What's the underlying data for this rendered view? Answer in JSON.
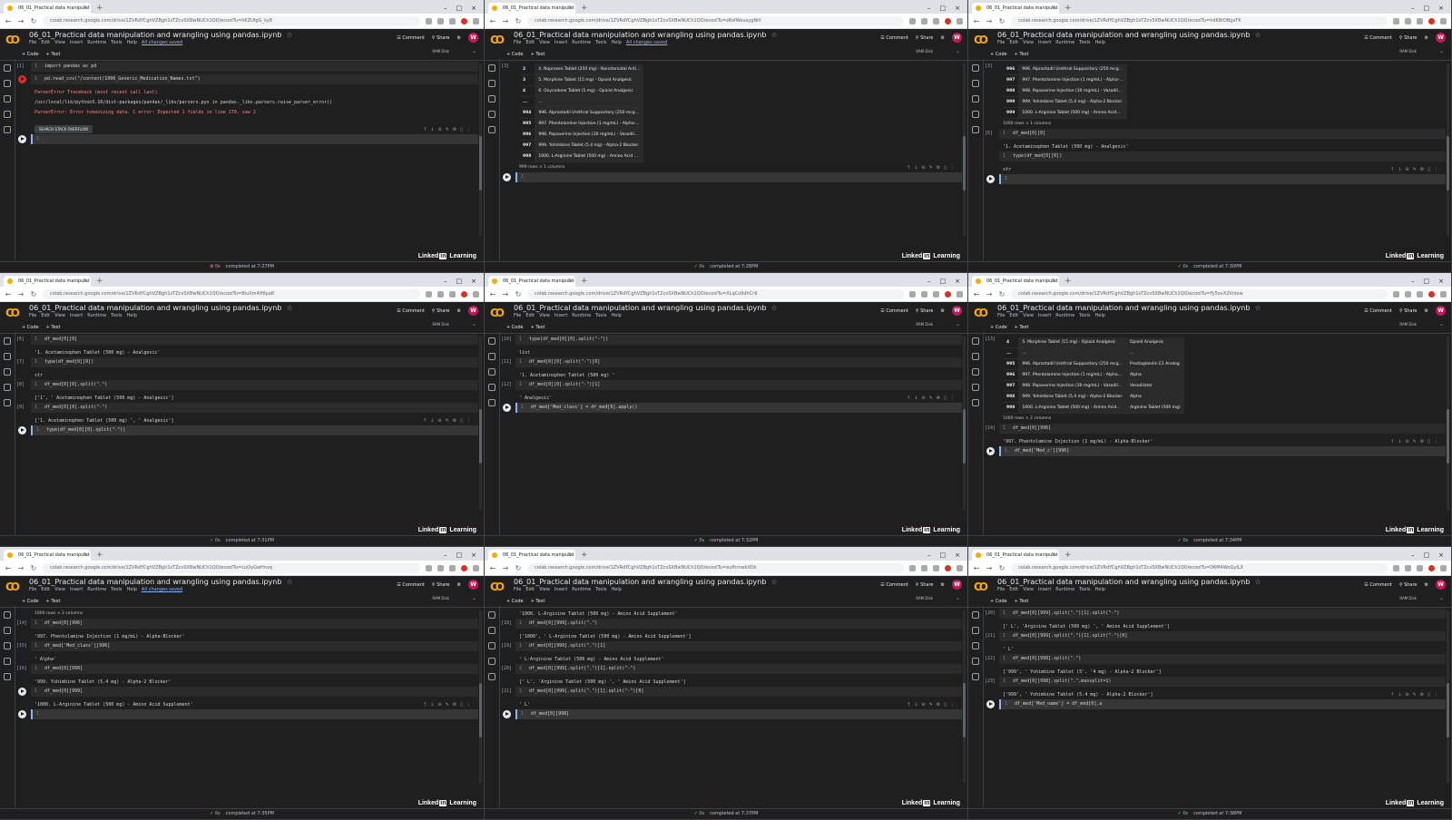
{
  "tab_title": "06_01_Practical data manipulat",
  "notebook_title": "06_01_Practical data manipulation and  wrangling using pandas.ipynb",
  "menus": [
    "File",
    "Edit",
    "View",
    "Insert",
    "Runtime",
    "Tools",
    "Help"
  ],
  "saved_text": "All changes saved",
  "header_buttons": {
    "comment": "Comment",
    "share": "Share",
    "avatar": "W"
  },
  "toolbar": {
    "code": "+ Code",
    "text": "+ Text",
    "ramdisk": "RAM Disk"
  },
  "watermark": "Linked in Learning",
  "url_prefix": "colab.research.google.com/drive/1ZVRdYCghVZBgh1sTZcvSXBwNUCh1QO/ecoolTu=",
  "panes": [
    {
      "url_suffix": "hKZUfgG_ky8",
      "show_saved": true,
      "status": "completed at 7:27PM",
      "status_sec": "0s",
      "status_err": true,
      "items": [
        {
          "k": "cell",
          "n": "[1]",
          "code": "import pandas as pd"
        },
        {
          "k": "cell",
          "n": "",
          "code": "pd.read_csv(\"/content/1000_Generic_Medication_Names.txt\")",
          "err": true
        },
        {
          "k": "out",
          "red": true,
          "text": "ParserError                          Traceback (most recent call last)"
        },
        {
          "k": "out",
          "text": "/usr/local/lib/python3.10/dist-packages/pandas/_libs/parsers.pyx in pandas._libs.parsers.raise_parser_error()"
        },
        {
          "k": "out",
          "red": true,
          "text": "ParserError: Error tokenizing data. C error: Expected 1 fields in line 170, saw 2"
        },
        {
          "k": "btn",
          "text": "SEARCH STACK OVERFLOW"
        },
        {
          "k": "cell",
          "n": "",
          "code": "",
          "run": true,
          "focus": true
        }
      ]
    },
    {
      "url_suffix": "zRsfWeusygNhl",
      "show_saved": true,
      "status": "completed at 7:28PM",
      "status_sec": "0s",
      "items": [
        {
          "k": "table",
          "n": "[3]",
          "rows": [
            [
              "2",
              "4. Naproxen Tablet (250 mg) - Nonsteroidal Anti..."
            ],
            [
              "3",
              "5. Morphine Tablet (15 mg) - Opioid Analgesic"
            ],
            [
              "4",
              "6. Oxycodone Tablet (5 mg) - Opioid Analgesic"
            ],
            [
              "...",
              "..."
            ],
            [
              "994",
              "996. Alprostadil Urethral Suppository (250 mcg..."
            ],
            [
              "995",
              "997. Phentolamine Injection (1 mg/mL) - Alpha-..."
            ],
            [
              "996",
              "998. Papaverine Injection (30 mg/mL) - Vasodil..."
            ],
            [
              "997",
              "999. Yohimbine Tablet (5.4 mg) - Alpha-2 Blocker"
            ],
            [
              "998",
              "1000. L-Arginine Tablet (500 mg) - Amino Acid ..."
            ]
          ]
        },
        {
          "k": "info",
          "text": "999 rows × 1 columns"
        },
        {
          "k": "cell",
          "n": "",
          "code": "",
          "run": true,
          "focus": true
        }
      ]
    },
    {
      "url_suffix": "hdK8rDBgsTK",
      "show_saved": false,
      "status": "completed at 7:30PM",
      "status_sec": "0s",
      "items": [
        {
          "k": "table",
          "n": "[3]",
          "rows": [
            [
              "996",
              "996. Alprostadil Urethral Suppository (250 mcg..."
            ],
            [
              "997",
              "997. Phentolamine Injection (1 mg/mL) - Alpha-..."
            ],
            [
              "998",
              "998. Papaverine Injection (30 mg/mL) - Vasodil..."
            ],
            [
              "999",
              "999. Yohimbine Tablet (5.4 mg) - Alpha-2 Blocker"
            ],
            [
              "999",
              "1000. L-Arginine Tablet (500 mg) - Amino Acid..."
            ]
          ]
        },
        {
          "k": "info",
          "text": "1000 rows × 1 columns"
        },
        {
          "k": "cell",
          "n": "[6]",
          "code": "df_med[0][0]"
        },
        {
          "k": "out",
          "text": "'1. Acetaminophen Tablet (500 mg) - Analgesic'"
        },
        {
          "k": "cell",
          "n": "",
          "code": "type(df_med[0][0])"
        },
        {
          "k": "out",
          "text": "str"
        },
        {
          "k": "cell",
          "n": "",
          "code": "",
          "run": true,
          "focus": true
        }
      ]
    },
    {
      "url_suffix": "BiuXm4H6pa8",
      "show_saved": false,
      "status": "completed at 7:31PM",
      "status_sec": "0s",
      "items": [
        {
          "k": "cell",
          "n": "[6]",
          "code": "df_med[0][0]"
        },
        {
          "k": "out",
          "text": "'1. Acetaminophen Tablet (500 mg) - Analgesic'"
        },
        {
          "k": "cell",
          "n": "[7]",
          "code": "type(df_med[0][0])"
        },
        {
          "k": "out",
          "text": "str"
        },
        {
          "k": "cell",
          "n": "[8]",
          "code": "df_med[0][0].split(\".\")"
        },
        {
          "k": "out",
          "text": "['1', ' Acetaminophen Tablet (500 mg) - Analgesic']"
        },
        {
          "k": "cell",
          "n": "[9]",
          "code": "df_med[0][0].split(\"-\")"
        },
        {
          "k": "out",
          "text": "['1. Acetaminophen Tablet (500 mg) ', ' Analgesic']"
        },
        {
          "k": "cell",
          "n": "",
          "code": "type(df_med[0][0].split(\"-\"))",
          "run": true,
          "focus": true
        }
      ]
    },
    {
      "url_suffix": "XLqCo9dhCr9",
      "show_saved": false,
      "status": "completed at 7:32PM",
      "status_sec": "0s",
      "items": [
        {
          "k": "cell",
          "n": "[10]",
          "code": "type(df_med[0][0].split(\"-\"))"
        },
        {
          "k": "out",
          "text": "list"
        },
        {
          "k": "cell",
          "n": "[11]",
          "code": "df_med[0][0].split(\"-\")[0]"
        },
        {
          "k": "out",
          "text": "'1. Acetaminophen Tablet (500 mg) '"
        },
        {
          "k": "cell",
          "n": "[12]",
          "code": "df_med[0][0].split(\"-\")[1]"
        },
        {
          "k": "out",
          "text": "' Analgesic'"
        },
        {
          "k": "cell",
          "n": "",
          "code": "df_med['Med_class'] = df_med[0].apply()",
          "run": true,
          "focus": true
        }
      ]
    },
    {
      "url_suffix": "Fy5ovX2Vnlow",
      "show_saved": false,
      "status": "completed at 7:34PM",
      "status_sec": "0s",
      "items": [
        {
          "k": "table",
          "n": "[13]",
          "rows": [
            [
              "4",
              "5. Morphine Tablet (15 mg) - Opioid Analgesic",
              "Opioid Analgesic"
            ],
            [
              "...",
              "...",
              "..."
            ],
            [
              "995",
              "996. Alprostadil Urethral Suppository (250 mcg...",
              "Prostaglandin E1 Analog"
            ],
            [
              "996",
              "997. Phentolamine Injection (1 mg/mL) - Alpha...",
              "Alpha"
            ],
            [
              "997",
              "998. Papaverine Injection (30 mg/mL) - Vasodil...",
              "Vasodilator"
            ],
            [
              "998",
              "999. Yohimbine Tablet (5.4 mg) - Alpha-2 Blocker",
              "Alpha"
            ],
            [
              "999",
              "1000. L-Arginine Tablet (500 mg) - Amino Acid...",
              "Arginine Tablet (500 mg)"
            ]
          ]
        },
        {
          "k": "info",
          "text": "1000 rows × 2 columns"
        },
        {
          "k": "cell",
          "n": "[14]",
          "code": "df_med[0][996]"
        },
        {
          "k": "out",
          "text": "'997. Phentolamine Injection (1 mg/mL) - Alpha-Blocker'"
        },
        {
          "k": "cell",
          "n": "",
          "code": "df_med['Med_c'][996]",
          "run": true,
          "focus": true
        }
      ]
    },
    {
      "url_suffix": "cuOyGwHnvq",
      "show_saved": true,
      "status": "completed at 7:35PM",
      "status_sec": "0s",
      "items": [
        {
          "k": "info",
          "text": "1000 rows × 2 columns"
        },
        {
          "k": "cell",
          "n": "[14]",
          "code": "df_med[0][996]"
        },
        {
          "k": "out",
          "text": "'997. Phentolamine Injection (1 mg/mL) - Alpha-Blocker'"
        },
        {
          "k": "cell",
          "n": "[15]",
          "code": "df_med['Med_class'][996]"
        },
        {
          "k": "out",
          "text": "' Alpha'"
        },
        {
          "k": "cell",
          "n": "[16]",
          "code": "df_med[0][998]"
        },
        {
          "k": "out",
          "text": "'999. Yohimbine Tablet (5.4 mg) - Alpha-2 Blocker'"
        },
        {
          "k": "cell",
          "n": "",
          "code": "df_med[0][999]",
          "run": true
        },
        {
          "k": "out",
          "text": "'1000. L-Arginine Tablet (500 mg) - Amino Acid Supplement'"
        },
        {
          "k": "cell",
          "n": "",
          "code": "",
          "run": true,
          "focus": true
        }
      ]
    },
    {
      "url_suffix": "eufhrnwkXOk",
      "show_saved": false,
      "status": "completed at 7:37PM",
      "status_sec": "0s",
      "items": [
        {
          "k": "out",
          "text": "'1000. L-Arginine Tablet (500 mg) - Amino Acid Supplement'"
        },
        {
          "k": "cell",
          "n": "[18]",
          "code": "df_med[0][999].split(\".\")"
        },
        {
          "k": "out",
          "text": "['1000', ' L-Arginine Tablet (500 mg) - Amino Acid Supplement']"
        },
        {
          "k": "cell",
          "n": "[19]",
          "code": "df_med[0][999].split(\".\")[1]"
        },
        {
          "k": "out",
          "text": "' L-Arginine Tablet (500 mg) - Amino Acid Supplement'"
        },
        {
          "k": "cell",
          "n": "[20]",
          "code": "df_med[0][999].split(\".\")[1].split(\"-\")"
        },
        {
          "k": "out",
          "text": "[' L', 'Arginine Tablet (500 mg) ', ' Amino Acid Supplement']"
        },
        {
          "k": "cell",
          "n": "[21]",
          "code": "df_med[0][999].split(\".\")[1].split(\"-\")[0]"
        },
        {
          "k": "out",
          "text": "' L'"
        },
        {
          "k": "cell",
          "n": "",
          "code": "df_med[0][998]",
          "run": true,
          "focus": true
        }
      ]
    },
    {
      "url_suffix": "D6M4WoGyILX",
      "show_saved": false,
      "status": "completed at 7:38PM",
      "status_sec": "0s",
      "items": [
        {
          "k": "cell",
          "n": "[20]",
          "code": "df_med[0][999].split(\".\")[1].split(\"-\")"
        },
        {
          "k": "out",
          "text": "[' L', 'Arginine Tablet (500 mg) ', ' Amino Acid Supplement']"
        },
        {
          "k": "cell",
          "n": "[21]",
          "code": "df_med[0][999].split(\".\")[1].split(\"-\")[0]"
        },
        {
          "k": "out",
          "text": "' L'"
        },
        {
          "k": "cell",
          "n": "[22]",
          "code": "df_med[0][998].split(\".\")"
        },
        {
          "k": "out",
          "text": "['999', ' Yohimbine Tablet (5', '4 mg) - Alpha-2 Blocker']"
        },
        {
          "k": "cell",
          "n": "[23]",
          "code": "df_med[0][998].split(\".\",maxsplit=1)"
        },
        {
          "k": "out",
          "text": "['999', ' Yohimbine Tablet (5.4 mg) - Alpha-2 Blocker']"
        },
        {
          "k": "cell",
          "n": "",
          "code": "df_med['Med_name'] = df_med[0].a",
          "run": true,
          "focus": true
        }
      ]
    }
  ]
}
